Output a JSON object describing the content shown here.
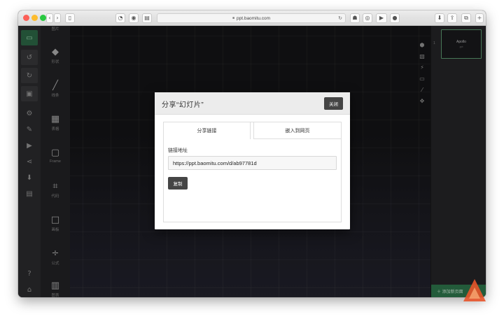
{
  "browser": {
    "url": "ppt.baomitu.com",
    "toolbar_icons": [
      "sidebar-icon",
      "rss-icon",
      "globe-icon",
      "reader-icon",
      "reload-icon",
      "extension-icon",
      "eye-icon",
      "video-icon",
      "record-icon",
      "download-icon",
      "share-icon",
      "tabs-icon"
    ]
  },
  "rail": {
    "items": [
      {
        "icon": "▭",
        "name": "slide-icon"
      },
      {
        "icon": "↺",
        "name": "undo-icon"
      },
      {
        "icon": "↻",
        "name": "redo-icon"
      },
      {
        "icon": "▣",
        "name": "save-icon"
      },
      {
        "icon": "⚙",
        "name": "gear-icon"
      },
      {
        "icon": "✎",
        "name": "brush-icon"
      },
      {
        "icon": "▶",
        "name": "play-icon"
      },
      {
        "icon": "⋖",
        "name": "share-icon"
      },
      {
        "icon": "⬇",
        "name": "download-icon"
      },
      {
        "icon": "▤",
        "name": "layout-icon"
      },
      {
        "icon": "?",
        "name": "help-icon"
      },
      {
        "icon": "⌂",
        "name": "home-icon"
      }
    ]
  },
  "tools": {
    "top_label": "图片",
    "items": [
      {
        "icon": "◆",
        "label": "形状",
        "name": "shape"
      },
      {
        "icon": "╱",
        "label": "线条",
        "name": "line"
      },
      {
        "icon": "▦",
        "label": "表格",
        "name": "table"
      },
      {
        "icon": "▢",
        "label": "Frame",
        "name": "frame"
      },
      {
        "icon": "⌗",
        "label": "代码",
        "name": "code"
      },
      {
        "icon": "□",
        "label": "画板",
        "name": "artboard"
      },
      {
        "icon": "÷",
        "label": "公式",
        "name": "formula"
      },
      {
        "icon": "▥",
        "label": "图表",
        "name": "chart"
      }
    ]
  },
  "canvas": {
    "side_icons": [
      "⬢",
      "▧",
      "⚡",
      "▭",
      "⁄",
      "✥"
    ]
  },
  "slides": {
    "thumb_title": "Apollo",
    "thumb_sub": "ppt",
    "slide_number": "1",
    "add_slide_label": "＋ 添加新页面"
  },
  "modal": {
    "title": "分享“幻灯片”",
    "close_label": "关闭",
    "tabs": [
      "分享链接",
      "嵌入到网页"
    ],
    "field_label": "链接地址",
    "link_value": "https://ppt.baomitu.com/d/ab97781d",
    "copy_label": "复制"
  },
  "colors": {
    "accent_green": "#2f7a4e",
    "modal_button": "#454545",
    "logo_orange": "#e8542a"
  }
}
